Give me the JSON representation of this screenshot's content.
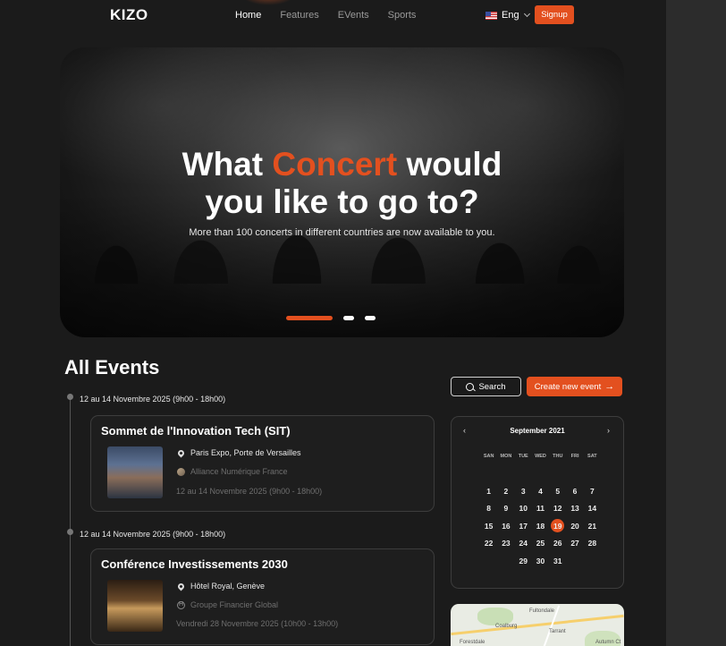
{
  "nav": {
    "logo": "KIZO",
    "links": [
      "Home",
      "Features",
      "EVents",
      "Sports"
    ],
    "active_link": "Home",
    "language": "Eng",
    "signup_label": "Signup"
  },
  "hero": {
    "title_part1": "What ",
    "title_accent": "Concert",
    "title_part2": " would",
    "title_line2": "you like to go to?",
    "subtitle": "More than 100 concerts in different countries are now available to you.",
    "slides_count": 3,
    "active_slide": 1
  },
  "events": {
    "heading": "All Events",
    "items": [
      {
        "date_header": "12 au 14 Novembre 2025 (9h00 - 18h00)",
        "title": "Sommet de l'Innovation Tech (SIT)",
        "location": "Paris Expo, Porte de Versailles",
        "organizer": "Alliance Numérique France",
        "schedule": "12 au 14 Novembre 2025 (9h00 - 18h00)"
      },
      {
        "date_header": "12 au 14 Novembre 2025 (9h00 - 18h00)",
        "title": "Conférence Investissements 2030",
        "location": "Hôtel Royal, Genève",
        "organizer": "Groupe Financier Global",
        "schedule": "Vendredi 28 Novembre 2025 (10h00 - 13h00)"
      }
    ]
  },
  "actions": {
    "search_label": "Search",
    "create_label": "Create new event",
    "create_arrow": "→"
  },
  "calendar": {
    "month_label": "September 2021",
    "prev": "‹",
    "next": "›",
    "weekdays": [
      "SAN",
      "MON",
      "TUE",
      "WED",
      "THU",
      "FRI",
      "SAT"
    ],
    "weeks": [
      [
        "",
        "",
        "",
        "",
        "",
        "",
        ""
      ],
      [
        "1",
        "2",
        "3",
        "4",
        "5",
        "6",
        "7"
      ],
      [
        "8",
        "9",
        "10",
        "11",
        "12",
        "13",
        "14"
      ],
      [
        "15",
        "16",
        "17",
        "18",
        "19",
        "20",
        "21"
      ],
      [
        "22",
        "23",
        "24",
        "25",
        "26",
        "27",
        "28"
      ],
      [
        "",
        "",
        "29",
        "30",
        "31",
        "",
        ""
      ]
    ],
    "selected_day": "19"
  },
  "map": {
    "labels": [
      "Fultondale",
      "Coalburg",
      "Tarrant",
      "Forestdale",
      "Autumn Ct"
    ]
  },
  "colors": {
    "accent": "#e3501f",
    "background": "#1b1b1b",
    "card_border": "#3d3d3d"
  }
}
